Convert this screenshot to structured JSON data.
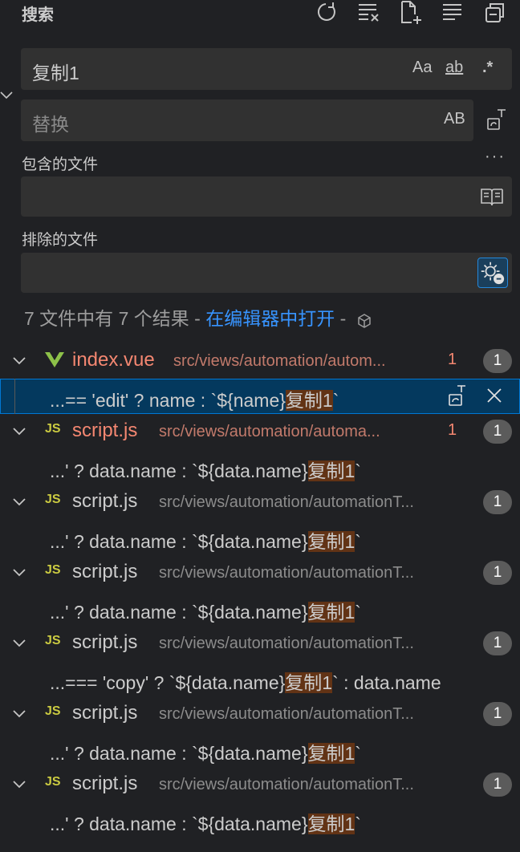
{
  "header": {
    "title": "搜索"
  },
  "search": {
    "value": "复制1"
  },
  "search_options": {
    "case": "Aa",
    "word": "ab",
    "regex": ".*"
  },
  "replace": {
    "placeholder": "替换",
    "preserve_case": "AB"
  },
  "include": {
    "label": "包含的文件"
  },
  "exclude": {
    "label": "排除的文件"
  },
  "summary": {
    "text": "7 文件中有 7 个结果 - ",
    "link": "在编辑器中打开",
    "sep": " -"
  },
  "results": [
    {
      "icon": "vue-icon",
      "name": "index.vue",
      "path": "src/views/automation/autom...",
      "errors": "1",
      "count": "1",
      "match": {
        "before": "...== 'edit' ? name : `${name}",
        "hl": "复制1",
        "after": "`"
      }
    },
    {
      "icon": "js-icon",
      "icon_text": "JS",
      "name": "script.js",
      "path": "src/views/automation/automa...",
      "errors": "1",
      "count": "1",
      "match": {
        "before": "...' ? data.name : `${data.name}",
        "hl": "复制1",
        "after": "`"
      }
    },
    {
      "icon": "js-icon",
      "icon_text": "JS",
      "name": "script.js",
      "path": "src/views/automation/automationT...",
      "count": "1",
      "match": {
        "before": "...' ? data.name : `${data.name}",
        "hl": "复制1",
        "after": "`"
      }
    },
    {
      "icon": "js-icon",
      "icon_text": "JS",
      "name": "script.js",
      "path": "src/views/automation/automationT...",
      "count": "1",
      "match": {
        "before": "...' ? data.name : `${data.name}",
        "hl": "复制1",
        "after": "`"
      }
    },
    {
      "icon": "js-icon",
      "icon_text": "JS",
      "name": "script.js",
      "path": "src/views/automation/automationT...",
      "count": "1",
      "match": {
        "before": "...=== 'copy' ? `${data.name}",
        "hl": "复制1",
        "after": "` : data.name"
      }
    },
    {
      "icon": "js-icon",
      "icon_text": "JS",
      "name": "script.js",
      "path": "src/views/automation/automationT...",
      "count": "1",
      "match": {
        "before": "...' ? data.name : `${data.name}",
        "hl": "复制1",
        "after": "`"
      }
    },
    {
      "icon": "js-icon",
      "icon_text": "JS",
      "name": "script.js",
      "path": "src/views/automation/automationT...",
      "count": "1",
      "match": {
        "before": "...' ? data.name : `${data.name}",
        "hl": "复制1",
        "after": "`"
      }
    }
  ],
  "colors": {
    "accent": "#3794ff",
    "error": "#f48771",
    "highlight": "#623315",
    "selected": "#04395e"
  }
}
